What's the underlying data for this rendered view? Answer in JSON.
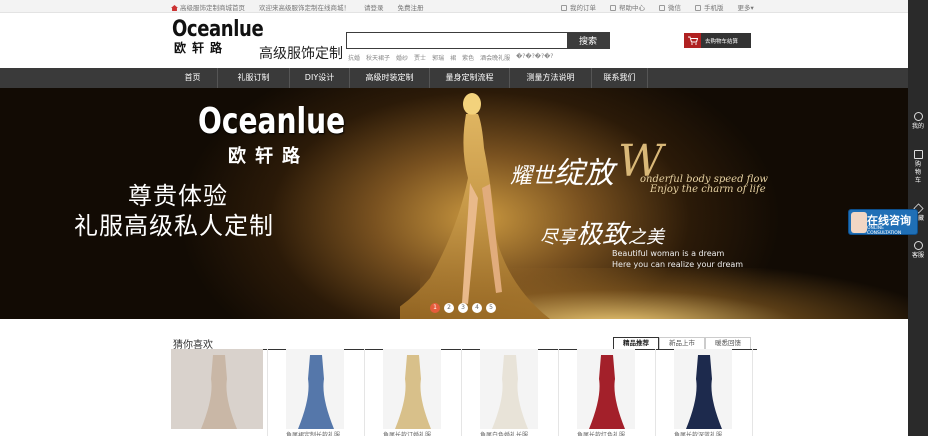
{
  "topbar": {
    "home_link": "高级服饰定制商城首页",
    "welcome": "欢迎来高级服饰定制在线商城！",
    "login": "请登录",
    "register": "免费注册",
    "my_orders": "我的订单",
    "help": "帮助中心",
    "wechat": "微信",
    "mobile": "手机版",
    "more": "更多▾"
  },
  "header": {
    "logo_en": "Oceanlue",
    "logo_cn": "欧轩路",
    "slogan": "高级服饰定制",
    "search_placeholder": "",
    "search_button": "搜索",
    "hotwords": [
      "抗婚",
      "秋天裙子",
      "婚纱",
      "贾士",
      "郭瑞",
      "裙",
      "紫色",
      "酒会晚礼服",
      "�?�?�?�?"
    ],
    "cart_label": "去购物车结算"
  },
  "nav": {
    "items": [
      "首页",
      "礼服订制",
      "DIY设计",
      "高级时装定制",
      "量身定制流程",
      "测量方法说明",
      "联系我们"
    ]
  },
  "banner": {
    "brand_en": "Oceanlue",
    "brand_cn": "欧轩路",
    "headline1": "尊贵体验",
    "headline2": "礼服高级私人定制",
    "slogan_a_small": "耀世",
    "slogan_a_big": "绽放",
    "script_letter": "W",
    "script_line1": "onderful body speed flow",
    "script_line2": "Enjoy the charm of life",
    "slogan_b_small": "尽享",
    "slogan_b_big": "极致",
    "slogan_b_end": "之美",
    "en_line1": "Beautiful woman is a dream",
    "en_line2": "Here you can realize your dream",
    "slides": [
      "1",
      "2",
      "3",
      "4",
      "5"
    ],
    "active_slide": "1"
  },
  "section": {
    "title": "猜你喜欢",
    "tabs": [
      "精品推荐",
      "新品上市",
      "暖悉回馈"
    ],
    "active_tab": "精品推荐",
    "products": [
      {
        "name": "",
        "color": "#c9b7a6"
      },
      {
        "name": "鱼尾裙定制长款礼服",
        "color": "#5577aa"
      },
      {
        "name": "鱼尾长款订婚礼服",
        "color": "#d8c08a"
      },
      {
        "name": "鱼尾白色婚礼长服",
        "color": "#e8e3d8"
      },
      {
        "name": "鱼尾长款红色礼服",
        "color": "#a3202a"
      },
      {
        "name": "鱼尾长款深蓝礼服",
        "color": "#1d2a4d"
      }
    ]
  },
  "sidebar": {
    "mine": "我的",
    "cart": "购物车",
    "favorites": "收藏",
    "service": "客服",
    "consult_cn": "在线咨询",
    "consult_en": "ONLINE CONSULTATION"
  },
  "colors": {
    "nav_bg": "#3a3a3a",
    "cart_accent": "#b02121",
    "sidebar_bg": "#2a2a2a",
    "consult_blue": "#1f6fb6",
    "slide_active": "#e55c3c"
  }
}
